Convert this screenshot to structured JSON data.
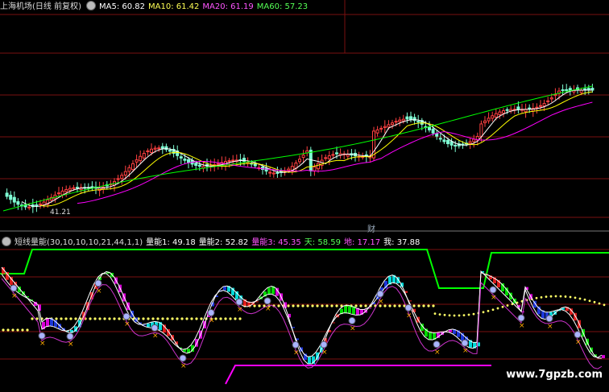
{
  "main": {
    "title": "上海机场(日线 前复权)",
    "ma5": "MA5: 60.82",
    "ma10": "MA10: 61.42",
    "ma20": "MA20: 61.19",
    "ma60": "MA60: 57.23",
    "low_label": "41.21",
    "divider_label": "财",
    "settings_icon": "gear-icon"
  },
  "indicator": {
    "name": "短线量能",
    "params": "(30,10,10,10,21,44,1,1)",
    "v1": "量能1: 49.18",
    "v2": "量能2: 52.82",
    "v3": "量能3: 45.35",
    "tian": "天: 58.59",
    "di": "地: 17.17",
    "wo": "我: 37.88",
    "settings_icon": "gear-icon"
  },
  "watermark": "www.7gpzb.com",
  "colors": {
    "background": "#000000",
    "up": "#ff4040",
    "down": "#7fffd4",
    "ma5": "#ffffff",
    "ma10": "#ffff00",
    "ma20": "#ff00ff",
    "ma60": "#00ff00",
    "grid": "#7a1010"
  }
}
